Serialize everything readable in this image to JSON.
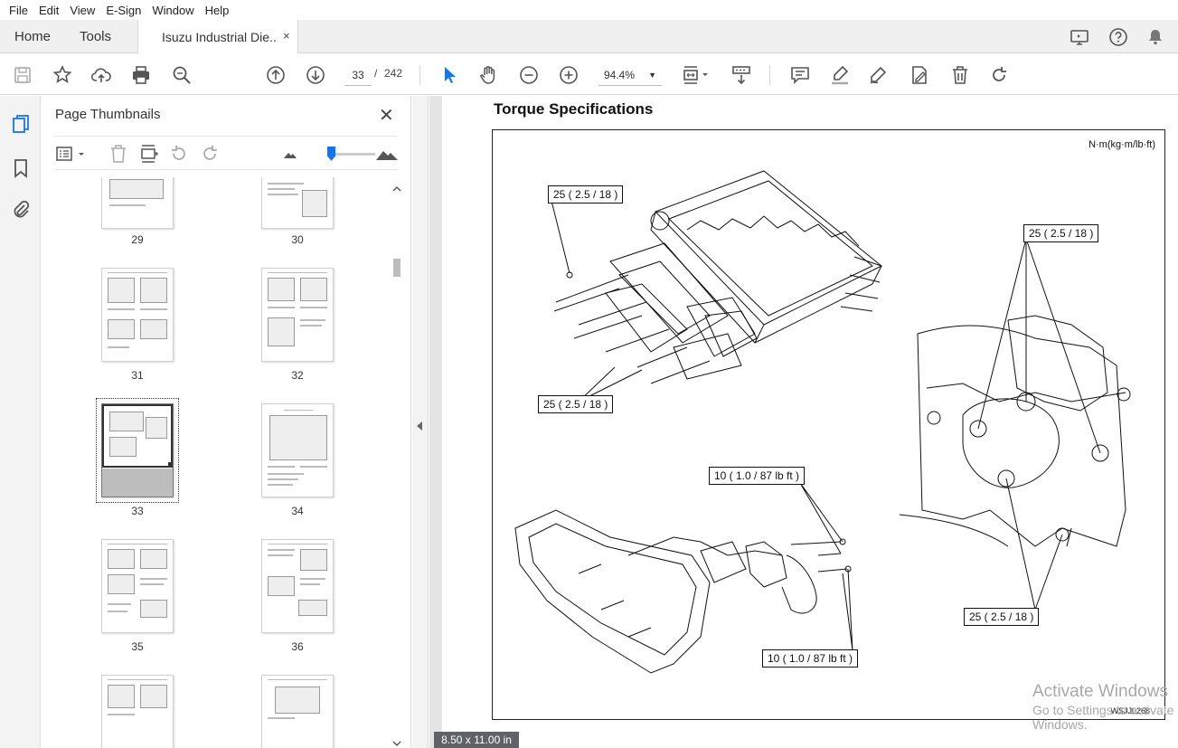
{
  "menu": [
    "File",
    "Edit",
    "View",
    "E-Sign",
    "Window",
    "Help"
  ],
  "tabs": {
    "home": "Home",
    "tools": "Tools",
    "document_title": "Isuzu Industrial Die...",
    "close": "×"
  },
  "toolbar": {
    "current_page": "33",
    "page_separator": "/",
    "total_pages": "242",
    "zoom": "94.4%"
  },
  "thumbnails_panel": {
    "title": "Page Thumbnails",
    "close": "✕",
    "pages": [
      "29",
      "30",
      "31",
      "32",
      "33",
      "34",
      "35",
      "36"
    ],
    "selected_page": "33"
  },
  "document": {
    "heading": "Torque Specifications",
    "unit_label": "N·m(kg·m/lb·ft)",
    "callouts": [
      "25 ( 2.5 / 18 )",
      "25 ( 2.5 / 18 )",
      "25 ( 2.5 / 18 )",
      "10 ( 1.0 / 87 lb ft )",
      "10 ( 1.0 / 87 lb ft )",
      "25 ( 2.5 / 18 )"
    ],
    "figure_code": "WSJJ0268",
    "page_size": "8.50 x 11.00 in"
  },
  "watermark": {
    "line1": "Activate Windows",
    "line2": "Go to Settings to activate Windows."
  },
  "colors": {
    "accent": "#1a73e8",
    "chrome": "#f0f0f0",
    "doc_background": "#e4e4e4"
  }
}
